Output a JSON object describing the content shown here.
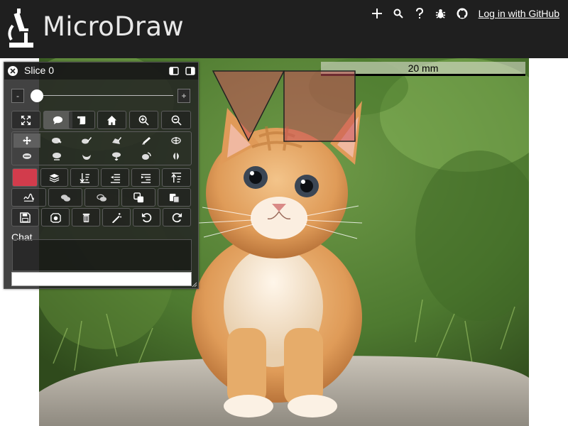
{
  "header": {
    "app_title": "MicroDraw",
    "login_label": "Log in with GitHub",
    "nav_icons": [
      "plus-icon",
      "search-icon",
      "help-icon",
      "bug-icon",
      "github-icon"
    ]
  },
  "viewer": {
    "scalebar_label": "20 mm",
    "image_subject": "kitten photo"
  },
  "panel": {
    "slice_label": "Slice 0",
    "slider_minus": "-",
    "slider_plus": "+",
    "slider_value": 0,
    "chat_label": "Chat",
    "chat_input_placeholder": "",
    "navigation_tools": [
      "fullscreen",
      "chat",
      "notes",
      "home",
      "zoom-in",
      "zoom-out"
    ],
    "selected_tools": [
      "chat",
      "move"
    ],
    "drawing_tools": [
      "move",
      "select",
      "draw",
      "draw-polygon",
      "draw-line",
      "add-point",
      "delete-point",
      "split",
      "shrink",
      "add-region",
      "rotate",
      "flip"
    ],
    "region_color": "#d23c4c"
  },
  "colors": {
    "header_bg": "#1f1f1f",
    "panel_bg": "#232323",
    "annotation_fill": "#c8505a"
  }
}
